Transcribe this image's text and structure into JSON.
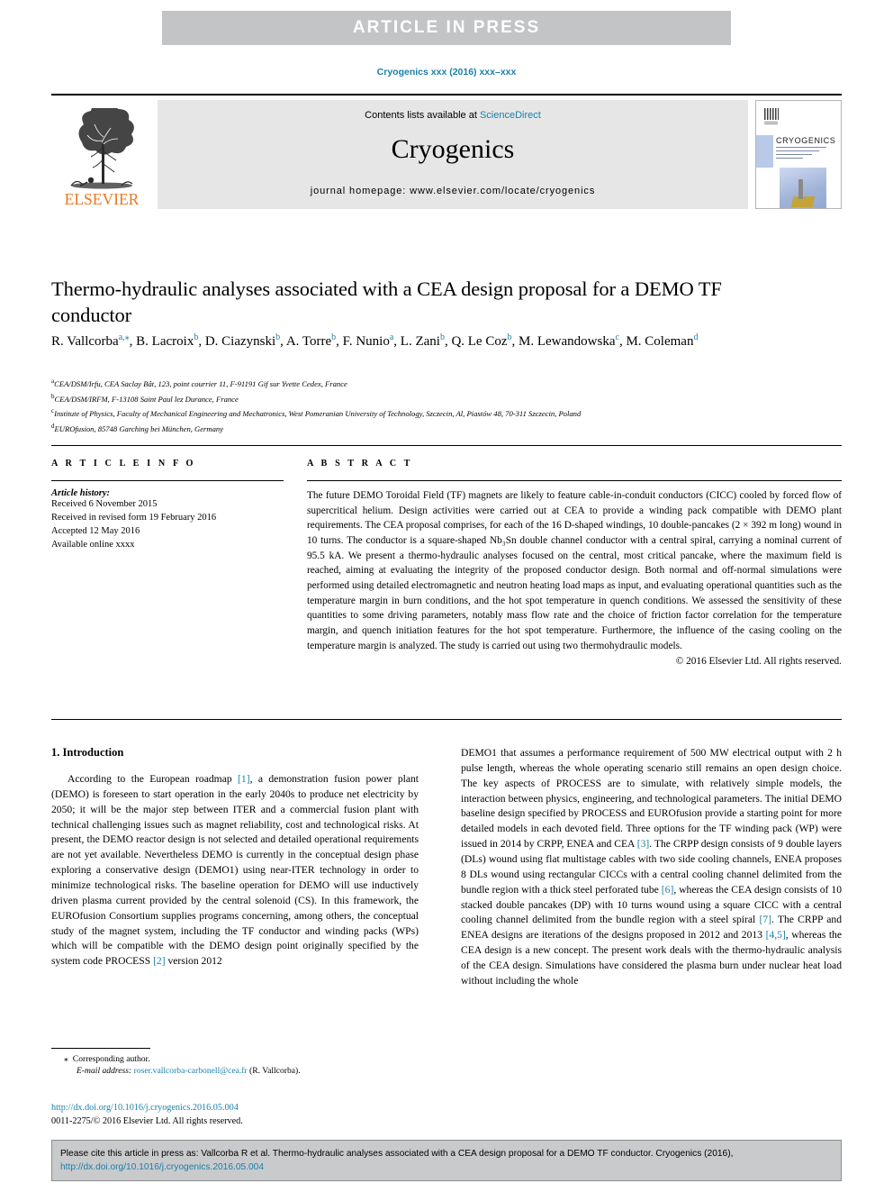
{
  "banner": {
    "text": "ARTICLE  IN  PRESS"
  },
  "journal_ref": "Cryogenics xxx (2016) xxx–xxx",
  "masthead": {
    "publisher": "ELSEVIER",
    "contents_prefix": "Contents lists available at ",
    "contents_link": "ScienceDirect",
    "journal_title": "Cryogenics",
    "homepage": "journal homepage: www.elsevier.com/locate/cryogenics",
    "cover_title": "CRYOGENICS"
  },
  "article": {
    "title": "Thermo-hydraulic analyses associated with a CEA design proposal for a DEMO TF conductor",
    "authors": [
      {
        "name": "R. Vallcorba",
        "marks": "a,⁎"
      },
      {
        "name": "B. Lacroix",
        "marks": "b"
      },
      {
        "name": "D. Ciazynski",
        "marks": "b"
      },
      {
        "name": "A. Torre",
        "marks": "b"
      },
      {
        "name": "F. Nunio",
        "marks": "a"
      },
      {
        "name": "L. Zani",
        "marks": "b"
      },
      {
        "name": "Q. Le Coz",
        "marks": "b"
      },
      {
        "name": "M. Lewandowska",
        "marks": "c"
      },
      {
        "name": "M. Coleman",
        "marks": "d"
      }
    ],
    "affiliations": [
      {
        "mark": "a",
        "text": "CEA/DSM/Irfu, CEA Saclay Bât, 123, point courrier 11, F-91191 Gif sur Yvette Cedex, France"
      },
      {
        "mark": "b",
        "text": "CEA/DSM/IRFM, F-13108 Saint Paul lez Durance, France"
      },
      {
        "mark": "c",
        "text": "Institute of Physics, Faculty of Mechanical Engineering and Mechatronics, West Pomeranian University of Technology, Szczecin, Al, Piastów 48, 70-311 Szczecin, Poland"
      },
      {
        "mark": "d",
        "text": "EUROfusion, 85748 Garching bei München, Germany"
      }
    ]
  },
  "info": {
    "heading": "A R T I C L E   I N F O",
    "history_label": "Article history:",
    "history": [
      "Received 6 November 2015",
      "Received in revised form 19 February 2016",
      "Accepted 12 May 2016",
      "Available online xxxx"
    ]
  },
  "abstract": {
    "heading": "A B S T R A C T",
    "text": "The future DEMO Toroidal Field (TF) magnets are likely to feature cable-in-conduit conductors (CICC) cooled by forced flow of supercritical helium. Design activities were carried out at CEA to provide a winding pack compatible with DEMO plant requirements. The CEA proposal comprises, for each of the 16 D-shaped windings, 10 double-pancakes (2 × 392 m long) wound in 10 turns. The conductor is a square-shaped Nb₃Sn double channel conductor with a central spiral, carrying a nominal current of 95.5 kA. We present a thermo-hydraulic analyses focused on the central, most critical pancake, where the maximum field is reached, aiming at evaluating the integrity of the proposed conductor design. Both normal and off-normal simulations were performed using detailed electromagnetic and neutron heating load maps as input, and evaluating operational quantities such as the temperature margin in burn conditions, and the hot spot temperature in quench conditions. We assessed the sensitivity of these quantities to some driving parameters, notably mass flow rate and the choice of friction factor correlation for the temperature margin, and quench initiation features for the hot spot temperature. Furthermore, the influence of the casing cooling on the temperature margin is analyzed. The study is carried out using two thermohydraulic models.",
    "copyright": "© 2016 Elsevier Ltd. All rights reserved."
  },
  "body": {
    "section_heading": "1. Introduction",
    "left_para_pre": "According to the European roadmap ",
    "left_ref1": "[1]",
    "left_para_mid": ", a demonstration fusion power plant (DEMO) is foreseen to start operation in the early 2040s to produce net electricity by 2050; it will be the major step between ITER and a commercial fusion plant with technical challenging issues such as magnet reliability, cost and technological risks. At present, the DEMO reactor design is not selected and detailed operational requirements are not yet available. Nevertheless DEMO is currently in the conceptual design phase exploring a conservative design (DEMO1) using near-ITER technology in order to minimize technological risks. The baseline operation for DEMO will use inductively driven plasma current provided by the central solenoid (CS). In this framework, the EUROfusion Consortium supplies programs concerning, among others, the conceptual study of the magnet system, including the TF conductor and winding packs (WPs) which will be compatible with the DEMO design point originally specified by the system code PROCESS ",
    "left_ref2": "[2]",
    "left_para_end": " version 2012",
    "right_p1": "DEMO1 that assumes a performance requirement of 500 MW electrical output with 2 h pulse length, whereas the whole operating scenario still remains an open design choice. The key aspects of PROCESS are to simulate, with relatively simple models, the interaction between physics, engineering, and technological parameters. The initial DEMO baseline design specified by PROCESS and EUROfusion provide a starting point for more detailed models in each devoted field. Three options for the TF winding pack (WP) were issued in 2014 by CRPP, ENEA and CEA ",
    "right_ref3": "[3]",
    "right_p2": ". The CRPP design consists of 9 double layers (DLs) wound using flat multistage cables with two side cooling channels, ENEA proposes 8 DLs wound using rectangular CICCs with a central cooling channel delimited from the bundle region with a thick steel perforated tube ",
    "right_ref6": "[6]",
    "right_p3": ", whereas the CEA design consists of 10 stacked double pancakes (DP) with 10 turns wound using a square CICC with a central cooling channel delimited from the bundle region with a steel spiral ",
    "right_ref7": "[7]",
    "right_p4": ". The CRPP and ENEA designs are iterations of the designs proposed in 2012 and 2013 ",
    "right_ref45": "[4,5]",
    "right_p5": ", whereas the CEA design is a new concept. The present work deals with the thermo-hydraulic analysis of the CEA design. Simulations have considered the plasma burn under nuclear heat load without including the whole"
  },
  "footnote": {
    "star": "⁎",
    "corresponding": "Corresponding author.",
    "email_label": "E-mail address:",
    "email": "roser.vallcorba-carbonell@cea.fr",
    "email_suffix": " (R. Vallcorba).",
    "doi_url": "http://dx.doi.org/10.1016/j.cryogenics.2016.05.004",
    "issn_line": "0011-2275/© 2016 Elsevier Ltd. All rights reserved."
  },
  "cite_box": {
    "text_pre": "Please cite this article in press as: Vallcorba R et al. Thermo-hydraulic analyses associated with a CEA design proposal for a DEMO TF conductor. Cryogenics (2016), ",
    "link": "http://dx.doi.org/10.1016/j.cryogenics.2016.05.004"
  },
  "colors": {
    "link": "#1b7fab",
    "banner_bg": "#c3c4c6",
    "elsevier_orange": "#e87722"
  }
}
